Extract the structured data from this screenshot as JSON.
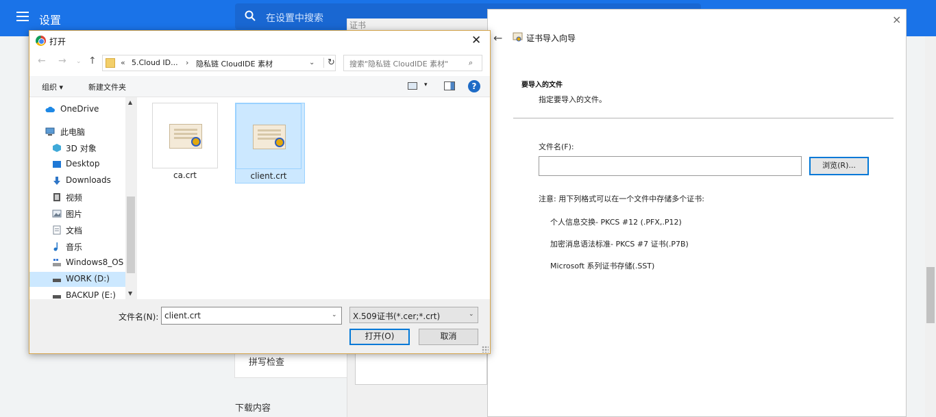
{
  "settings": {
    "title": "设置",
    "search_placeholder": "在设置中搜索",
    "panel_tab": "证书",
    "spellcheck": "拼写检查",
    "downloads": "下载内容"
  },
  "wizard": {
    "close": "×",
    "back": "←",
    "title": "证书导入向导",
    "heading": "要导入的文件",
    "subheading": "指定要导入的文件。",
    "file_label": "文件名(F):",
    "file_value": "",
    "browse_label": "浏览(R)...",
    "note": "注意: 用下列格式可以在一个文件中存储多个证书:",
    "formats": [
      "个人信息交换- PKCS #12 (.PFX,.P12)",
      "加密消息语法标准- PKCS #7 证书(.P7B)",
      "Microsoft 系列证书存储(.SST)"
    ]
  },
  "dialog": {
    "title": "打开",
    "close": "✕",
    "nav": {
      "back": "←",
      "forward": "→",
      "recent": "⌄",
      "up": "↑"
    },
    "address": {
      "prefix": "«",
      "segment1": "5.Cloud ID...",
      "separator": "›",
      "segment2": "隐私链 CloudIDE 素材",
      "dropdown": "⌄",
      "refresh": "↻"
    },
    "search_placeholder": "搜索\"隐私链 CloudIDE 素材\"",
    "search_icon": "⌕",
    "toolbar": {
      "organize": "组织 ▾",
      "new_folder": "新建文件夹",
      "view_drop": "▾",
      "help": "?"
    },
    "nav_items": [
      {
        "label": "OneDrive",
        "icon": "cloud-icon",
        "color": "#1e88e5"
      },
      {
        "label": "此电脑",
        "icon": "computer-icon",
        "color": "#5b9bd5"
      },
      {
        "label": "3D 对象",
        "icon": "cube-icon",
        "color": "#3fa9d8"
      },
      {
        "label": "Desktop",
        "icon": "desktop-icon",
        "color": "#1e78d6"
      },
      {
        "label": "Downloads",
        "icon": "download-arrow-icon",
        "color": "#2f76c7"
      },
      {
        "label": "视频",
        "icon": "film-icon",
        "color": "#555555"
      },
      {
        "label": "图片",
        "icon": "picture-icon",
        "color": "#6d7d8f"
      },
      {
        "label": "文档",
        "icon": "document-icon",
        "color": "#7b8794"
      },
      {
        "label": "音乐",
        "icon": "music-note-icon",
        "color": "#2577c9"
      },
      {
        "label": "Windows8_OS",
        "icon": "windows-drive-icon",
        "color": "#3a7bd5"
      },
      {
        "label": "WORK (D:)",
        "icon": "drive-icon",
        "color": "#555555"
      },
      {
        "label": "BACKUP (E:)",
        "icon": "drive-icon",
        "color": "#555555"
      }
    ],
    "scroll": {
      "up": "▲",
      "down": "▼"
    },
    "files": [
      {
        "name": "ca.crt",
        "selected": false
      },
      {
        "name": "client.crt",
        "selected": true
      }
    ],
    "filename_label": "文件名(N):",
    "filename_value": "client.crt",
    "filename_drop": "⌄",
    "filetype_value": "X.509证书(*.cer;*.crt)",
    "filetype_drop": "⌄",
    "open_button": "打开(O)",
    "cancel_button": "取消"
  }
}
